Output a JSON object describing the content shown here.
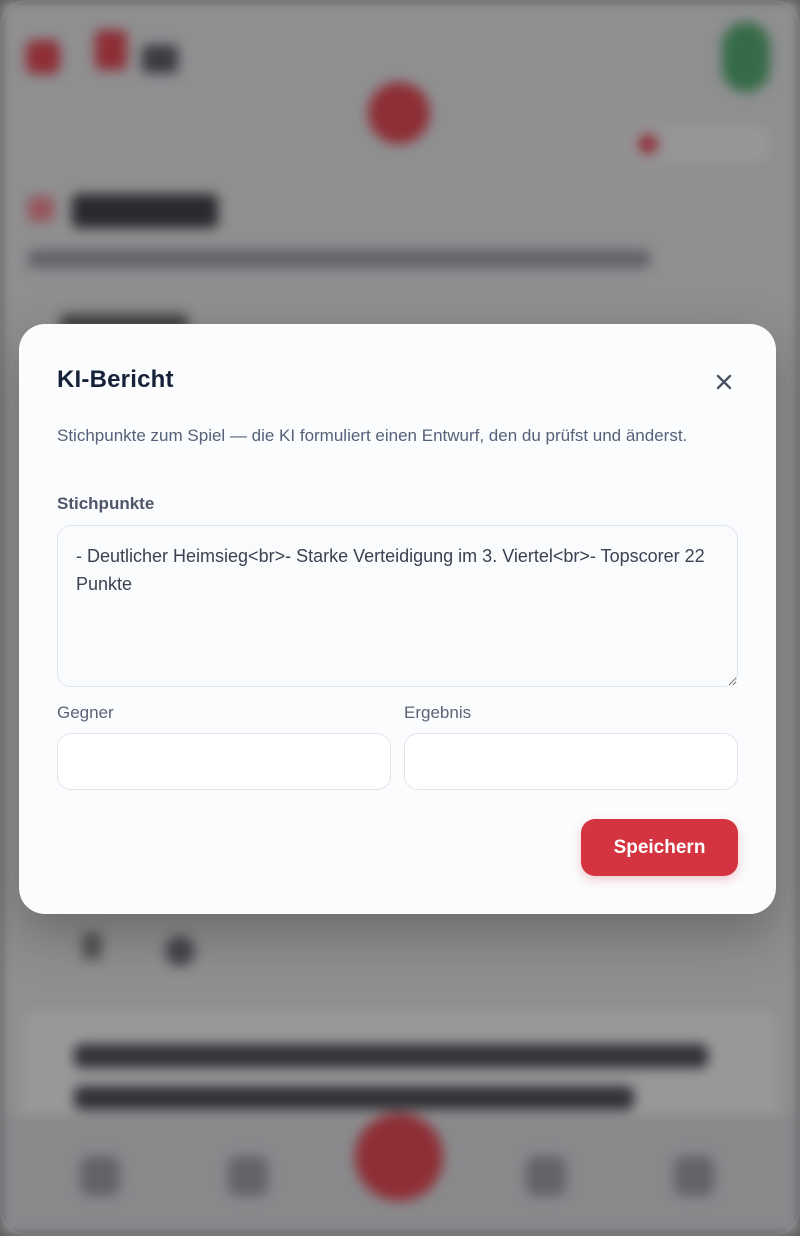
{
  "modal": {
    "title": "KI-Bericht",
    "description": "Stichpunkte zum Spiel — die KI formuliert einen Entwurf, den du prüfst und änderst.",
    "notes_label": "Stichpunkte",
    "notes_value": "- Deutlicher Heimsieg<br>- Starke Verteidigung im 3. Viertel<br>- Topscorer 22 Punkte",
    "opponent_label": "Gegner",
    "opponent_value": "",
    "result_label": "Ergebnis",
    "result_value": "",
    "save_label": "Speichern",
    "close_icon": "close-icon"
  },
  "colors": {
    "accent": "#d3343f",
    "title": "#16213a",
    "text_muted": "#55607a",
    "background_overlay": "#6b6b6d"
  }
}
